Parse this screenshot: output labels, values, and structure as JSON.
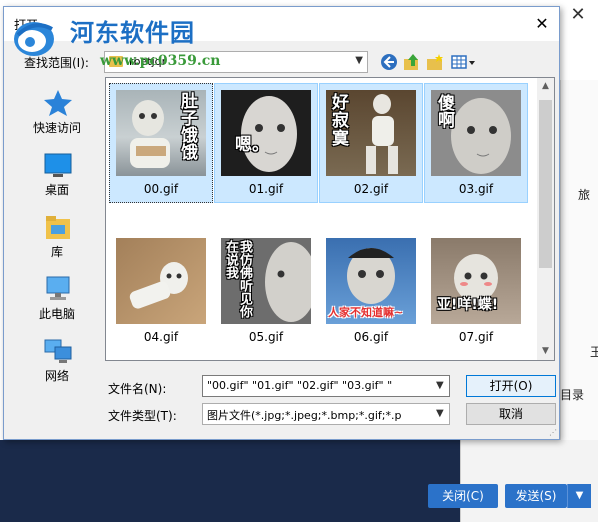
{
  "background": {
    "right_text_1": "旅",
    "right_text_2": "玉",
    "right_text_3": "目录",
    "close_button": "关闭(C)",
    "send_button": "发送(S)"
  },
  "dialog": {
    "title": "打开",
    "close_glyph": "✕",
    "look_in_label": "查找范围(I):",
    "look_in_value": "rbetjqr",
    "file_name_label": "文件名(N):",
    "file_name_value": "\"00.gif\" \"01.gif\" \"02.gif\" \"03.gif\" \"",
    "file_type_label": "文件类型(T):",
    "file_type_value": "图片文件(*.jpg;*.jpeg;*.bmp;*.gif;*.p",
    "open_button": "打开(O)",
    "cancel_button": "取消"
  },
  "watermark": {
    "name": "河东软件园",
    "url": "www.pc0359.cn"
  },
  "places": [
    {
      "label": "快速访问",
      "icon": "star-icon"
    },
    {
      "label": "桌面",
      "icon": "desktop-icon"
    },
    {
      "label": "库",
      "icon": "library-icon"
    },
    {
      "label": "此电脑",
      "icon": "computer-icon"
    },
    {
      "label": "网络",
      "icon": "network-icon"
    }
  ],
  "files": [
    {
      "name": "00.gif",
      "caption": "肚子饿饿",
      "selected": true
    },
    {
      "name": "01.gif",
      "caption": "嗯。",
      "selected": true
    },
    {
      "name": "02.gif",
      "caption": "好寂寞",
      "selected": true
    },
    {
      "name": "03.gif",
      "caption": "傻啊",
      "selected": true
    },
    {
      "name": "04.gif",
      "caption": "",
      "selected": false
    },
    {
      "name": "05.gif",
      "caption": "我仿佛听见你在说我",
      "selected": false
    },
    {
      "name": "06.gif",
      "caption": "人家不知道嘛~",
      "selected": false
    },
    {
      "name": "07.gif",
      "caption": "亚!咩!蝶!",
      "selected": false
    }
  ]
}
